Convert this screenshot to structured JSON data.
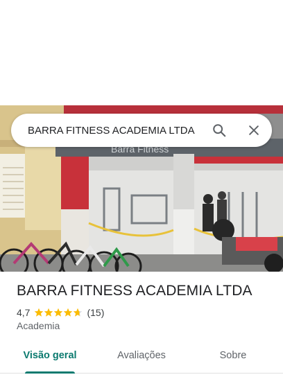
{
  "search": {
    "query": "BARRA FITNESS ACADEMIA LTDA"
  },
  "hero": {
    "sign_text": "Barra Fitness"
  },
  "place": {
    "name": "BARRA FITNESS ACADEMIA LTDA",
    "rating": "4,7",
    "stars": 4.7,
    "review_count": "(15)",
    "category": "Academia"
  },
  "tabs": [
    {
      "label": "Visão geral",
      "active": true
    },
    {
      "label": "Avaliações",
      "active": false
    },
    {
      "label": "Sobre",
      "active": false
    }
  ],
  "colors": {
    "accent": "#0b7a6f",
    "star": "#fbbc04",
    "storefront_red": "#c8313a"
  }
}
